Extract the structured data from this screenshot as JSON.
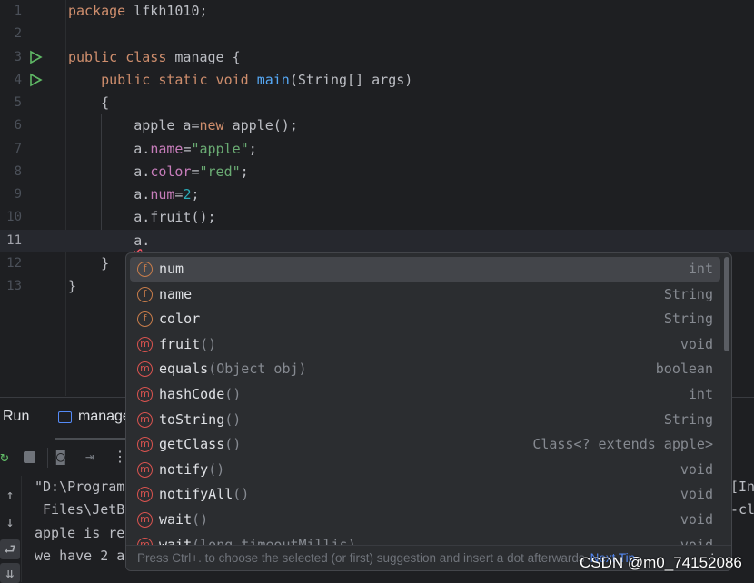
{
  "editor": {
    "lines": [
      {
        "n": "1",
        "parts": [
          [
            "kw",
            "package "
          ],
          [
            "",
            "lfkh1010;"
          ]
        ]
      },
      {
        "n": "2",
        "parts": []
      },
      {
        "n": "3",
        "run": true,
        "parts": [
          [
            "kw",
            "public class "
          ],
          [
            "",
            "manage {"
          ]
        ]
      },
      {
        "n": "4",
        "run": true,
        "parts": [
          [
            "",
            "    "
          ],
          [
            "kw",
            "public static void "
          ],
          [
            "fn",
            "main"
          ],
          [
            "",
            "(String[] args)"
          ]
        ]
      },
      {
        "n": "5",
        "parts": [
          [
            "",
            "    {"
          ]
        ]
      },
      {
        "n": "6",
        "parts": [
          [
            "",
            "        apple a="
          ],
          [
            "kw",
            "new "
          ],
          [
            "",
            "apple();"
          ]
        ]
      },
      {
        "n": "7",
        "parts": [
          [
            "",
            "        a."
          ],
          [
            "fld",
            "name"
          ],
          [
            "",
            "="
          ],
          [
            "str",
            "\"apple\""
          ],
          [
            "",
            ";"
          ]
        ]
      },
      {
        "n": "8",
        "parts": [
          [
            "",
            "        a."
          ],
          [
            "fld",
            "color"
          ],
          [
            "",
            "="
          ],
          [
            "str",
            "\"red\""
          ],
          [
            "",
            ";"
          ]
        ]
      },
      {
        "n": "9",
        "parts": [
          [
            "",
            "        a."
          ],
          [
            "fld",
            "num"
          ],
          [
            "",
            "="
          ],
          [
            "num",
            "2"
          ],
          [
            "",
            ";"
          ]
        ]
      },
      {
        "n": "10",
        "parts": [
          [
            "",
            "        a.fruit();"
          ]
        ]
      },
      {
        "n": "11",
        "current": true,
        "parts": [
          [
            "",
            "        "
          ],
          [
            "squig",
            "a"
          ],
          [
            "",
            "."
          ]
        ]
      },
      {
        "n": "12",
        "parts": [
          [
            "",
            "    }"
          ]
        ]
      },
      {
        "n": "13",
        "parts": [
          [
            "",
            "}"
          ]
        ]
      }
    ]
  },
  "run_panel": {
    "tab_run": "Run",
    "tab_config": "manage",
    "console": {
      "left": [
        "\"D:\\Program",
        " Files\\JetB",
        "apple is re",
        "we have 2 a"
      ],
      "right": [
        "[Int",
        "-cl"
      ]
    }
  },
  "completion": {
    "items": [
      {
        "kind": "f",
        "name": "num",
        "params": "",
        "type": "int",
        "selected": true
      },
      {
        "kind": "f",
        "name": "name",
        "params": "",
        "type": "String"
      },
      {
        "kind": "f",
        "name": "color",
        "params": "",
        "type": "String"
      },
      {
        "kind": "m",
        "name": "fruit",
        "params": "()",
        "type": "void"
      },
      {
        "kind": "m",
        "name": "equals",
        "params": "(Object obj)",
        "type": "boolean"
      },
      {
        "kind": "m",
        "name": "hashCode",
        "params": "()",
        "type": "int"
      },
      {
        "kind": "m",
        "name": "toString",
        "params": "()",
        "type": "String"
      },
      {
        "kind": "m",
        "name": "getClass",
        "params": "()",
        "type": "Class<? extends apple>"
      },
      {
        "kind": "m",
        "name": "notify",
        "params": "()",
        "type": "void"
      },
      {
        "kind": "m",
        "name": "notifyAll",
        "params": "()",
        "type": "void"
      },
      {
        "kind": "m",
        "name": "wait",
        "params": "()",
        "type": "void"
      },
      {
        "kind": "m",
        "name": "wait",
        "params": "(long timeoutMillis)",
        "type": "void"
      }
    ],
    "footer_hint": "Press Ctrl+. to choose the selected (or first) suggestion and insert a dot afterwards",
    "next_tip": "Next Tip"
  },
  "watermark": "CSDN @m0_74152086",
  "colors": {
    "keyword": "#cf8e6d",
    "function": "#56a8f5",
    "field": "#c77dbb",
    "string": "#6aab73",
    "number": "#2aacb8",
    "accent": "#548af7"
  }
}
